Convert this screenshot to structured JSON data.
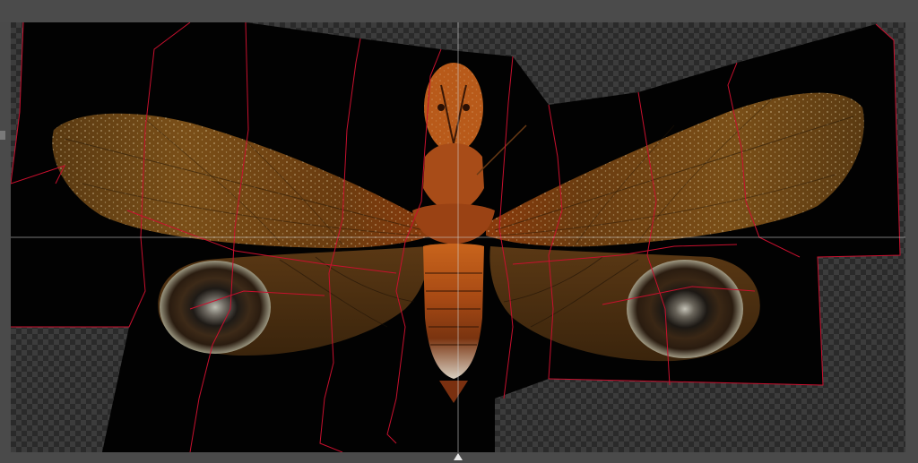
{
  "workspace": {
    "background_color": "#4a4a4a",
    "transparency_checker": [
      "#2a2a2a",
      "#3c3c3c"
    ]
  },
  "image": {
    "subject_icon": "moth-specimen-image",
    "seam_color": "#c8102e",
    "guide_color": "#cfcfcf"
  },
  "guides": {
    "vertical_guide_icon": "guide-line-icon",
    "horizontal_guide_icon": "guide-line-icon"
  },
  "markers": {
    "bottom_marker_icon": "triangle-up-icon",
    "left_marker_icon": "tick-icon"
  }
}
